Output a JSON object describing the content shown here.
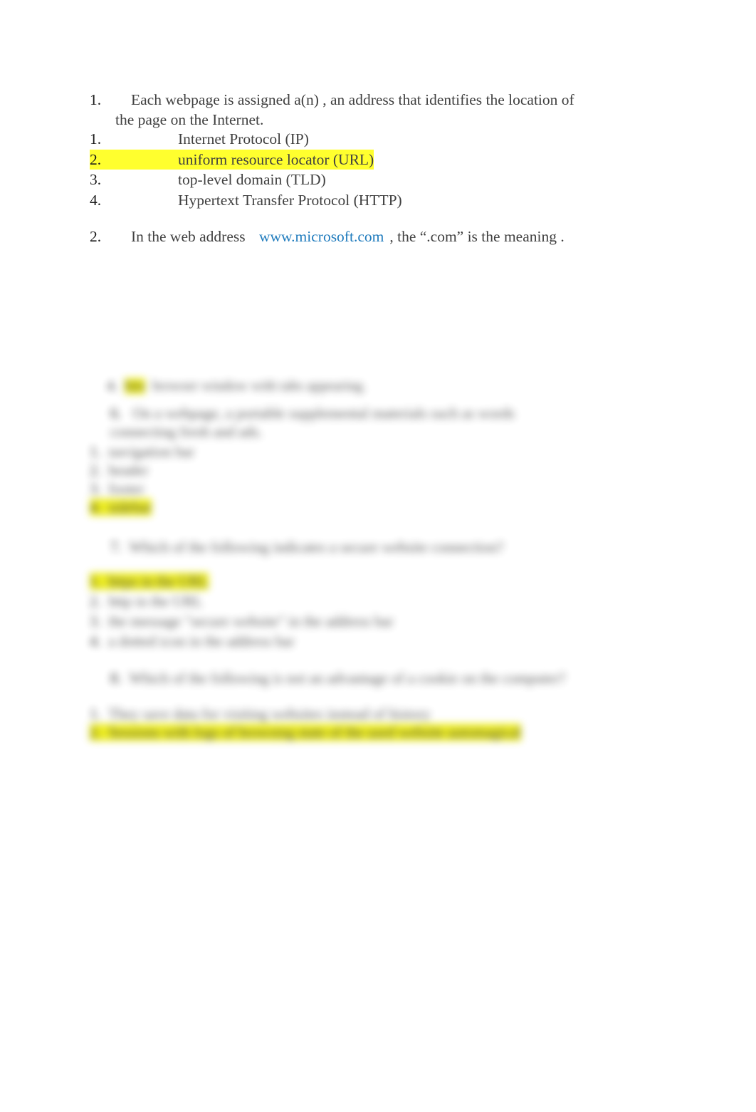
{
  "document": {
    "background_color": "#ffffff",
    "text_color": "#404040",
    "number_color": "#1a1a1a",
    "highlight_color": "#ffff2e",
    "link_color": "#1f7bbd"
  },
  "questions": [
    {
      "number": "1.",
      "prompt_line1": "Each webpage is assigned a(n) , an address that identifies the location of",
      "prompt_line2": "the page on the Internet.",
      "choices": [
        {
          "number": "1.",
          "text": "Internet Protocol (IP)",
          "highlighted": false
        },
        {
          "number": "2.",
          "text": "uniform resource locator (URL)",
          "highlighted": true
        },
        {
          "number": "3.",
          "text": "top-level domain (TLD)",
          "highlighted": false
        },
        {
          "number": "4.",
          "text": "Hypertext Transfer Protocol (HTTP)",
          "highlighted": false
        }
      ]
    },
    {
      "number": "2.",
      "prompt_prefix": "In the web address",
      "link_text": "www.microsoft.com",
      "prompt_suffix": ", the “.com” is the meaning ."
    }
  ],
  "blurred_section": {
    "legible": false,
    "note": "lower portion of page is out of focus and unreadable",
    "lines": [
      {
        "id": "cut-line",
        "text": "",
        "highlighted": false
      },
      {
        "id": "q-blur-1-line1",
        "text": "",
        "highlighted": false
      },
      {
        "id": "q-blur-1-line2",
        "text": "",
        "highlighted": false
      },
      {
        "id": "q-blur-1-choice-1",
        "text": "",
        "highlighted": false
      },
      {
        "id": "q-blur-1-choice-2",
        "text": "",
        "highlighted": false
      },
      {
        "id": "q-blur-1-choice-3",
        "text": "",
        "highlighted": false
      },
      {
        "id": "q-blur-1-choice-4",
        "text": "",
        "highlighted": true
      },
      {
        "id": "q-blur-2-prompt",
        "text": "",
        "highlighted": false
      },
      {
        "id": "q-blur-2-choice-1",
        "text": "",
        "highlighted": true
      },
      {
        "id": "q-blur-2-choice-2",
        "text": "",
        "highlighted": false
      },
      {
        "id": "q-blur-2-choice-3",
        "text": "",
        "highlighted": false
      },
      {
        "id": "q-blur-2-choice-4",
        "text": "",
        "highlighted": false
      },
      {
        "id": "q-blur-3-prompt",
        "text": "",
        "highlighted": false
      },
      {
        "id": "q-blur-3-choice-1",
        "text": "",
        "highlighted": false
      },
      {
        "id": "q-blur-3-choice-2",
        "text": "",
        "highlighted": true
      }
    ]
  }
}
